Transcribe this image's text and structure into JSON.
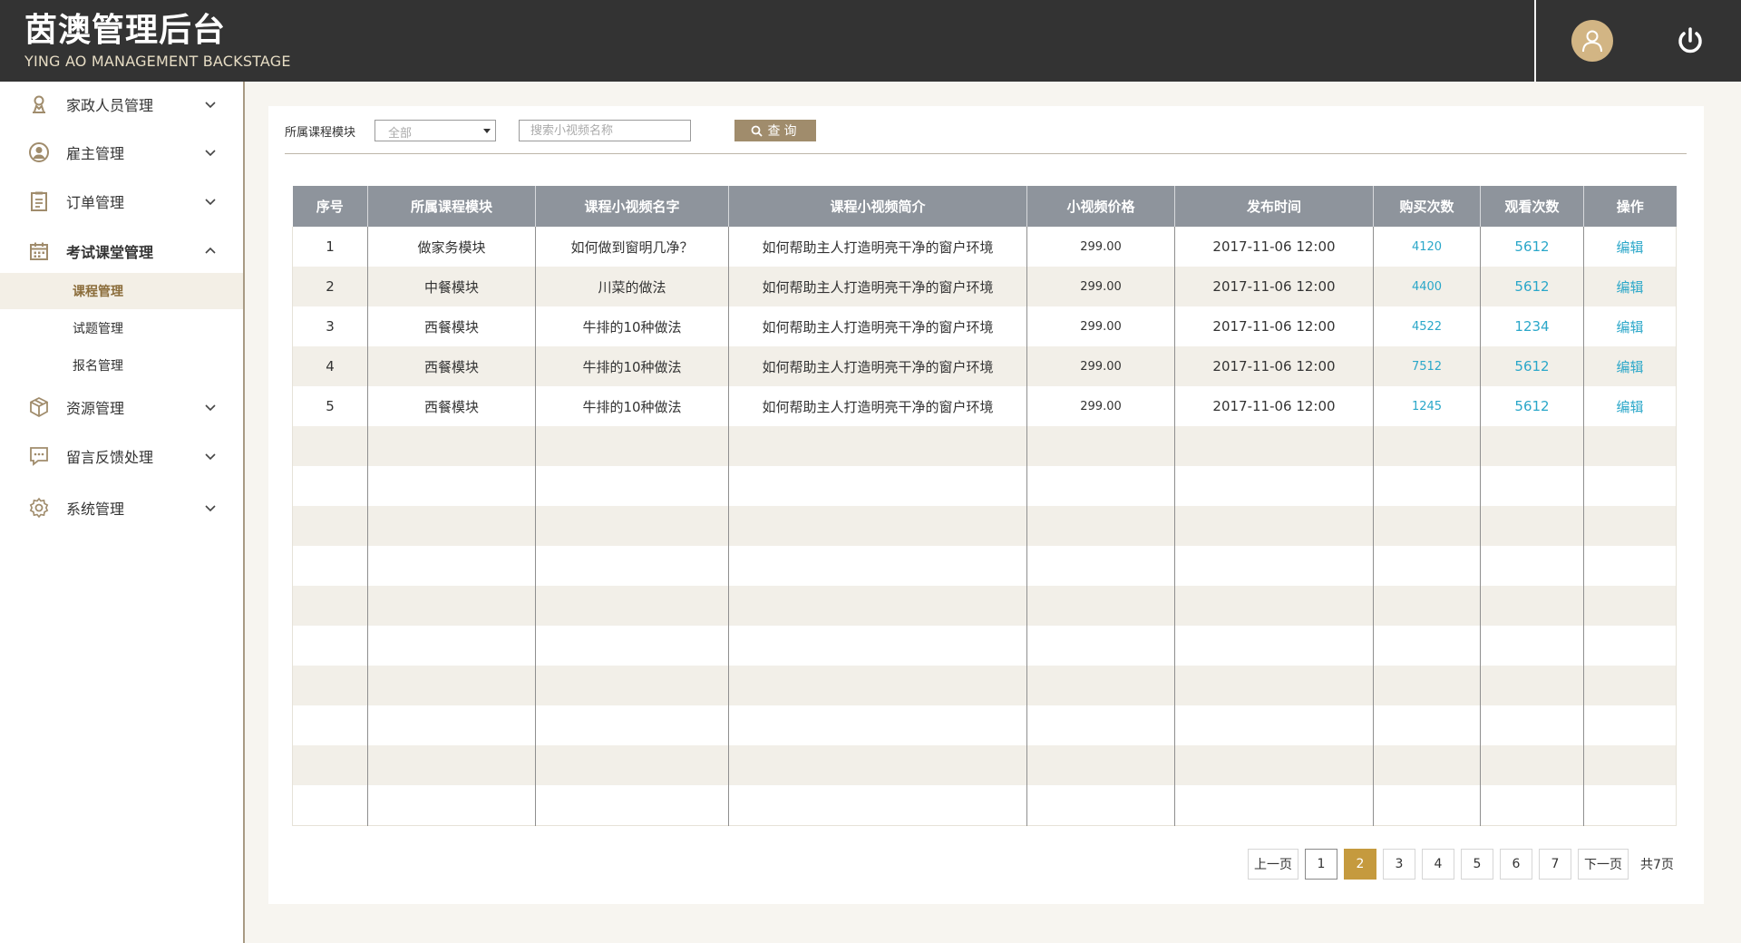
{
  "header": {
    "title": "茵澳管理后台",
    "subtitle": "YING AO MANAGEMENT BACKSTAGE"
  },
  "sidebar": {
    "items": [
      {
        "label": "家政人员管理",
        "icon": "person-pin-icon",
        "expanded": false
      },
      {
        "label": "雇主管理",
        "icon": "user-circle-icon",
        "expanded": false
      },
      {
        "label": "订单管理",
        "icon": "clipboard-icon",
        "expanded": false
      },
      {
        "label": "考试课堂管理",
        "icon": "calendar-icon",
        "expanded": true,
        "children": [
          {
            "label": "课程管理",
            "active": true
          },
          {
            "label": "试题管理",
            "active": false
          },
          {
            "label": "报名管理",
            "active": false
          }
        ]
      },
      {
        "label": "资源管理",
        "icon": "package-icon",
        "expanded": false
      },
      {
        "label": "留言反馈处理",
        "icon": "message-icon",
        "expanded": false
      },
      {
        "label": "系统管理",
        "icon": "gear-icon",
        "expanded": false
      }
    ]
  },
  "filter": {
    "module_label": "所属课程模块",
    "module_value": "全部",
    "search_placeholder": "搜索小视频名称",
    "query_label": "查询"
  },
  "table": {
    "columns": [
      "序号",
      "所属课程模块",
      "课程小视频名字",
      "课程小视频简介",
      "小视频价格",
      "发布时间",
      "购买次数",
      "观看次数",
      "操作"
    ],
    "rows": [
      {
        "no": "1",
        "module": "做家务模块",
        "name": "如何做到窗明几净？",
        "intro": "如何帮助主人打造明亮干净的窗户环境",
        "price": "299.00",
        "time": "2017-11-06 12:00",
        "buys": "4120",
        "views": "5612",
        "action": "编辑"
      },
      {
        "no": "2",
        "module": "中餐模块",
        "name": "川菜的做法",
        "intro": "如何帮助主人打造明亮干净的窗户环境",
        "price": "299.00",
        "time": "2017-11-06 12:00",
        "buys": "4400",
        "views": "5612",
        "action": "编辑"
      },
      {
        "no": "3",
        "module": "西餐模块",
        "name": "牛排的10种做法",
        "intro": "如何帮助主人打造明亮干净的窗户环境",
        "price": "299.00",
        "time": "2017-11-06 12:00",
        "buys": "4522",
        "views": "1234",
        "action": "编辑"
      },
      {
        "no": "4",
        "module": "西餐模块",
        "name": "牛排的10种做法",
        "intro": "如何帮助主人打造明亮干净的窗户环境",
        "price": "299.00",
        "time": "2017-11-06 12:00",
        "buys": "7512",
        "views": "5612",
        "action": "编辑"
      },
      {
        "no": "5",
        "module": "西餐模块",
        "name": "牛排的10种做法",
        "intro": "如何帮助主人打造明亮干净的窗户环境",
        "price": "299.00",
        "time": "2017-11-06 12:00",
        "buys": "1245",
        "views": "5612",
        "action": "编辑"
      }
    ],
    "empty_rows": 10
  },
  "pagination": {
    "prev": "上一页",
    "pages": [
      "1",
      "2",
      "3",
      "4",
      "5",
      "6",
      "7"
    ],
    "current": "2",
    "next": "下一页",
    "total": "共7页"
  },
  "colors": {
    "header_bg": "#333333",
    "accent_gold": "#c59a3e",
    "query_button": "#a08c6c",
    "table_header": "#8e949c",
    "link": "#2aa7c9",
    "row_alt": "#f2efe8"
  }
}
